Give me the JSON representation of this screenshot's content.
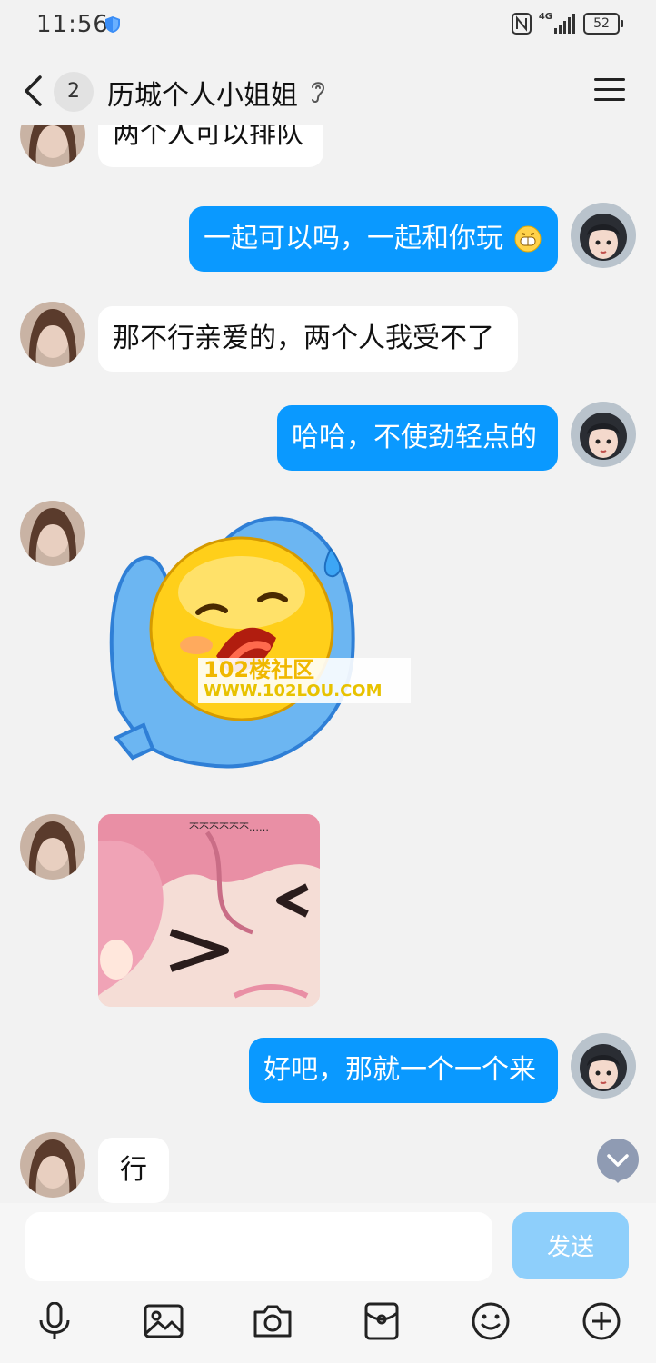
{
  "status_bar": {
    "time": "11:56",
    "network": "4G",
    "battery": "52"
  },
  "header": {
    "back_count": "2",
    "title": "历城个人小姐姐"
  },
  "messages": [
    {
      "side": "in",
      "text": "两个人可以排队"
    },
    {
      "side": "out",
      "text": "一起可以吗，一起和你玩",
      "emoji": "grinning-emoji"
    },
    {
      "side": "in",
      "text": "那不行亲爱的，两个人我受不了"
    },
    {
      "side": "out",
      "text": "哈哈，不使劲轻点的"
    },
    {
      "side": "in",
      "type": "sticker",
      "watermark": {
        "line1": "102楼社区",
        "line2": "WWW.102LOU.COM"
      }
    },
    {
      "side": "in",
      "type": "image",
      "caption": "不不不不不不……"
    },
    {
      "side": "out",
      "text": "好吧，那就一个一个来"
    },
    {
      "side": "in",
      "text": "行"
    }
  ],
  "composer": {
    "input_value": "",
    "send_label": "发送"
  },
  "colors": {
    "outgoing_bubble": "#0a99ff",
    "incoming_bubble": "#ffffff",
    "send_disabled": "#8ecffb",
    "background": "#f2f2f2"
  },
  "toolbar_icons": [
    "microphone-icon",
    "image-icon",
    "camera-icon",
    "red-packet-icon",
    "emoji-icon",
    "plus-icon"
  ]
}
